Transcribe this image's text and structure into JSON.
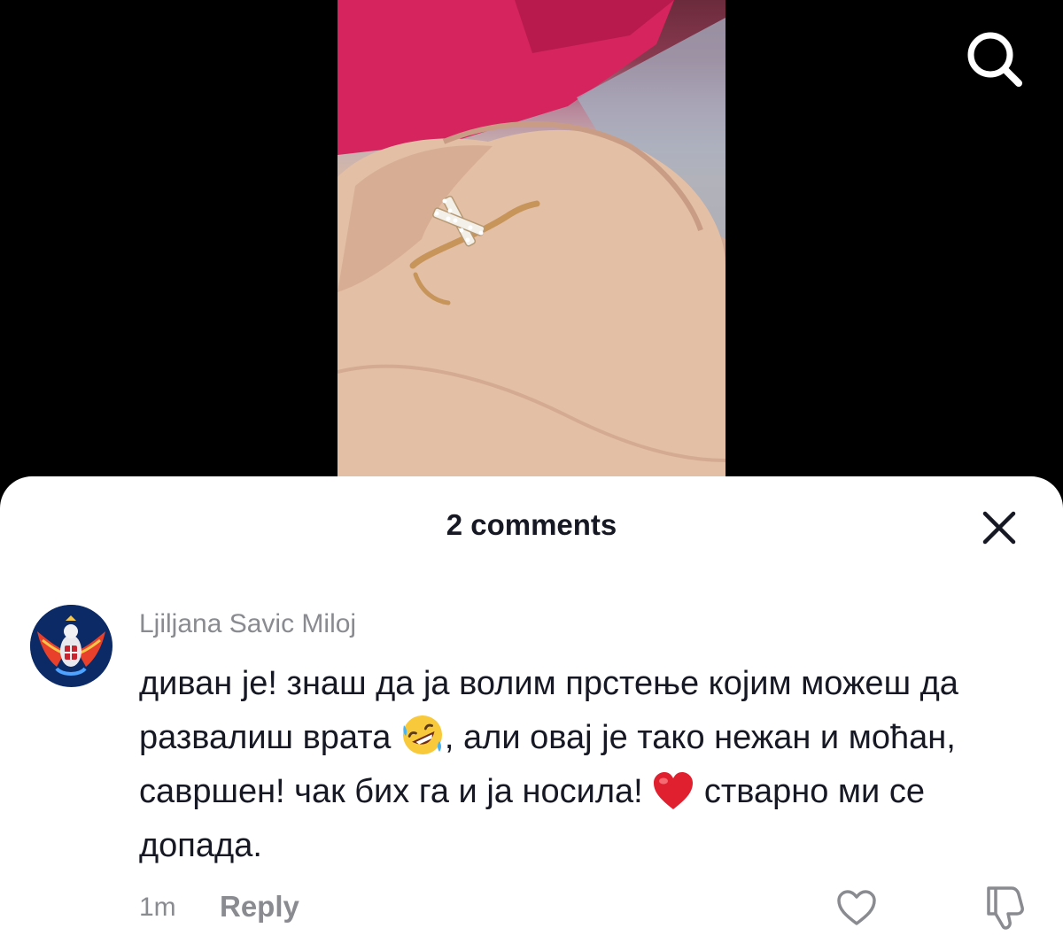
{
  "video": {
    "description_icon": "ring-photo"
  },
  "header": {
    "search_icon": "search-icon"
  },
  "comments_sheet": {
    "title": "2 comments",
    "close_icon": "close-icon"
  },
  "comments": [
    {
      "username": "Ljiljana Savic Miloj",
      "text_part1": "диван је! знаш да ја волим прстење којим можеш да развалиш врата",
      "emoji1": "rolling-on-floor-laughing-emoji",
      "text_part2": ", али овај је тако нежан и моћан, савршен! чак бих га и ја носила!",
      "emoji2": "red-heart-emoji",
      "text_part3": "стварно ми се допада.",
      "time": "1m",
      "reply_label": "Reply"
    }
  ],
  "colors": {
    "sheet_background": "#ffffff",
    "primary_text": "#161823",
    "secondary_text": "#8a8b91",
    "backdrop": "#000000"
  }
}
